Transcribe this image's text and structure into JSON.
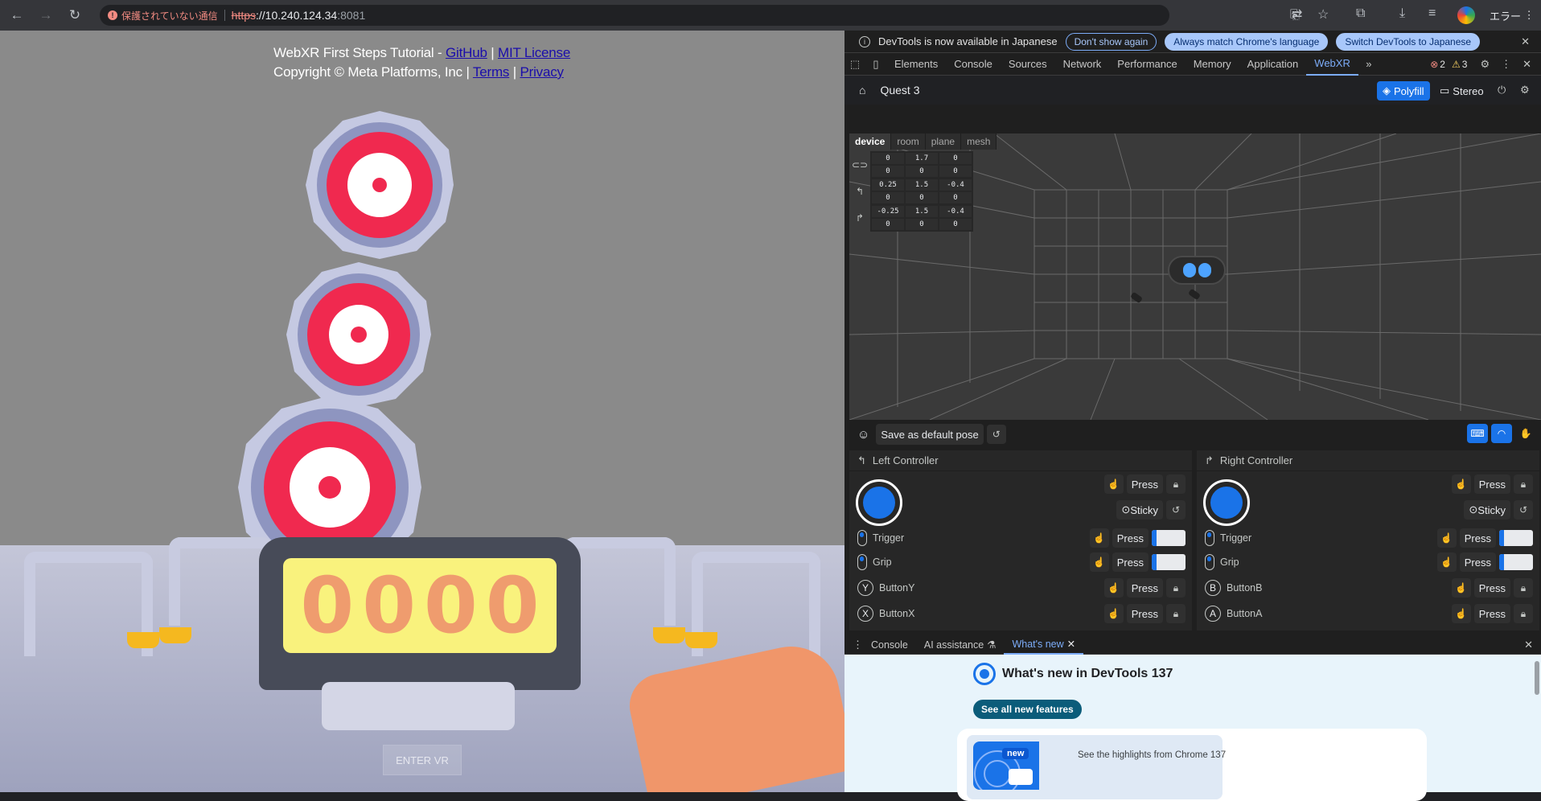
{
  "browser": {
    "security_label": "保護されていない通信",
    "url_scheme": "https",
    "url_host": "://10.240.124.34",
    "url_port": ":8081",
    "error_label": "エラー"
  },
  "page": {
    "credit_line1": "WebXR First Steps Tutorial - ",
    "github": "GitHub",
    "sep1": " | ",
    "mit": "MIT License",
    "credit_line2": "Copyright © Meta Platforms, Inc | ",
    "terms": "Terms",
    "sep2": " | ",
    "privacy": "Privacy",
    "score": [
      "0",
      "0",
      "0",
      "0"
    ],
    "enter_vr": "ENTER VR"
  },
  "devtools": {
    "info_text": "DevTools is now available in Japanese",
    "dont_show": "Don't show again",
    "always_match": "Always match Chrome's language",
    "switch_jp": "Switch DevTools to Japanese",
    "tabs": [
      "Elements",
      "Console",
      "Sources",
      "Network",
      "Performance",
      "Memory",
      "Application",
      "WebXR"
    ],
    "error_count": "2",
    "warning_count": "3",
    "device_name": "Quest 3",
    "polyfill": "Polyfill",
    "stereo": "Stereo",
    "view_tabs": [
      "device",
      "room",
      "plane",
      "mesh"
    ],
    "pose_rows": [
      [
        "0",
        "1.7",
        "0",
        "0",
        "0",
        "0"
      ],
      [
        "0.25",
        "1.5",
        "-0.4",
        "0",
        "0",
        "0"
      ],
      [
        "-0.25",
        "1.5",
        "-0.4",
        "0",
        "0",
        "0"
      ]
    ],
    "save_pose": "Save as default pose",
    "left_controller": {
      "title": "Left Controller",
      "press": "Press",
      "sticky": "Sticky",
      "trigger": "Trigger",
      "grip": "Grip",
      "b1": "ButtonY",
      "b1_letter": "Y",
      "b2": "ButtonX",
      "b2_letter": "X"
    },
    "right_controller": {
      "title": "Right Controller",
      "press": "Press",
      "sticky": "Sticky",
      "trigger": "Trigger",
      "grip": "Grip",
      "b1": "ButtonB",
      "b1_letter": "B",
      "b2": "ButtonA",
      "b2_letter": "A"
    },
    "drawer_tabs": {
      "console": "Console",
      "ai": "AI assistance",
      "whatsnew": "What's new"
    },
    "whatsnew_title": "What's new in DevTools 137",
    "see_all": "See all new features",
    "new_badge": "new",
    "highlights": "See the highlights from Chrome 137"
  },
  "colors": {
    "accent": "#1a73e8",
    "target_red": "#f0294f",
    "score_bg": "#f9f27d"
  }
}
